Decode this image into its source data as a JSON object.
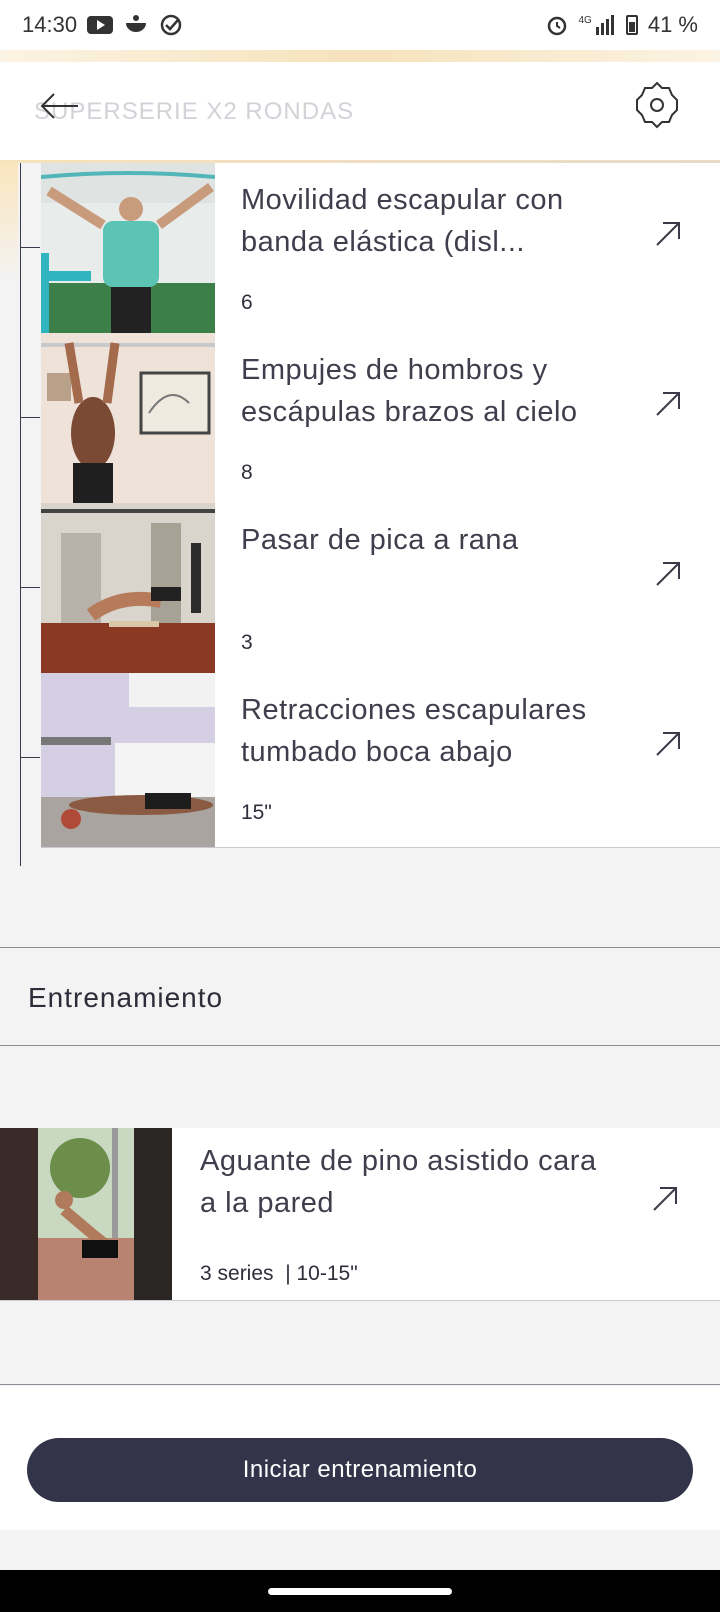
{
  "status_bar": {
    "time": "14:30",
    "battery": "41 %",
    "network": "4G"
  },
  "header": {
    "title": "SUPERSERIE X2 RONDAS"
  },
  "superset_exercises": [
    {
      "name": "Movilidad escapular con banda elástica (disl...",
      "reps": "6"
    },
    {
      "name": "Empujes de hombros y escápulas brazos al cielo",
      "reps": "8"
    },
    {
      "name": "Pasar de pica a rana",
      "reps": "3"
    },
    {
      "name": "Retracciones escapulares tumbado boca abajo",
      "reps": "15\""
    }
  ],
  "training_section": {
    "title": "Entrenamiento",
    "exercise": {
      "name": "Aguante de pino asistido cara a la pared",
      "reps": "3 series  | 10-15\""
    }
  },
  "start_button": {
    "label": "Iniciar entrenamiento"
  },
  "colors": {
    "button_bg": "#33344a",
    "accent_gold": "#f6e2bb",
    "background": "#f3f3f4"
  }
}
